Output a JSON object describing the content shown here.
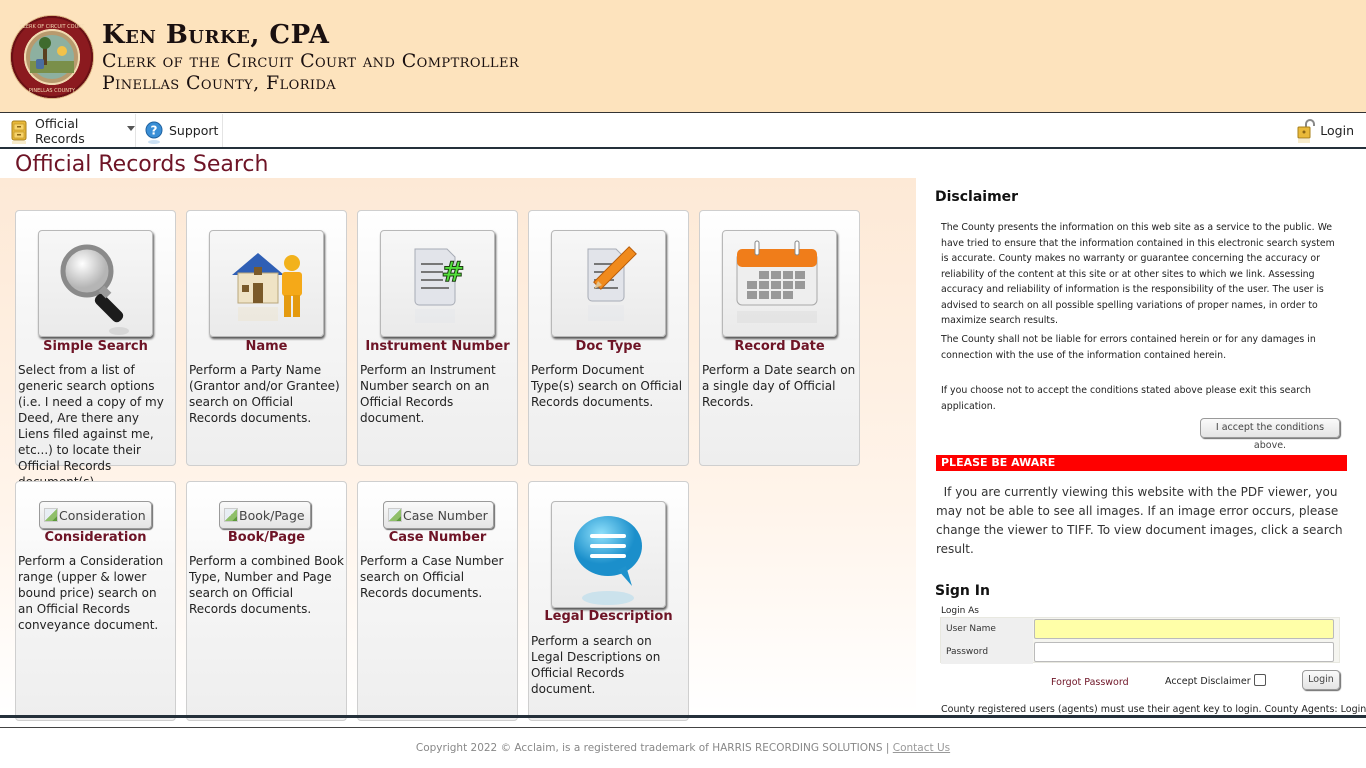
{
  "header": {
    "seal_alt": "Clerk of the Circuit Court & Comptroller Pinellas County Florida seal",
    "title": "Ken Burke, CPA",
    "subtitle_1": "Clerk of the Circuit Court and Comptroller",
    "subtitle_2": "Pinellas County, Florida"
  },
  "nav": {
    "items": [
      {
        "label": "Official Records",
        "icon": "file-cabinet-icon",
        "has_dropdown": true
      },
      {
        "label": "Support",
        "icon": "help-icon",
        "has_dropdown": false
      }
    ],
    "login_label": "Login"
  },
  "page_title": "Official Records Search",
  "search_tiles": [
    {
      "title": "Simple Search",
      "icon": "magnifier-icon",
      "description": "Select from a list of generic search options (i.e. I need a copy of my Deed, Are there any Liens filed against me, etc...) to locate their Official Records document(s)."
    },
    {
      "title": "Name",
      "icon": "house-person-icon",
      "description": "Perform a Party Name (Grantor and/or Grantee) search on Official Records documents."
    },
    {
      "title": "Instrument Number",
      "icon": "document-number-icon",
      "description": "Perform an Instrument Number search on an Official Records document."
    },
    {
      "title": "Doc Type",
      "icon": "document-pencil-icon",
      "description": "Perform Document Type(s) search on Official Records documents."
    },
    {
      "title": "Record Date",
      "icon": "calendar-icon",
      "description": "Perform a Date search on a single day of Official Records."
    },
    {
      "title": "Consideration",
      "button_alt": "Consideration",
      "description": "Perform a Consideration range (upper & lower bound price) search on an Official Records conveyance document."
    },
    {
      "title": "Book/Page",
      "button_alt": "Book/Page",
      "description": "Perform a combined Book Type, Number and Page search on Official Records documents."
    },
    {
      "title": "Case Number",
      "button_alt": "Case Number",
      "description": "Perform a Case Number search on Official Records documents."
    },
    {
      "title": "Legal Description",
      "icon": "speech-bubble-icon",
      "description": "Perform a search on Legal Descriptions on Official Records document."
    }
  ],
  "disclaimer": {
    "title": "Disclaimer",
    "paragraph_1": "The County presents the information on this web site as a service to the public. We have tried to ensure that the information contained in this electronic search system is accurate. County makes no warranty or guarantee concerning the accuracy or reliability of the content at this site or at other sites to which we link. Assessing accuracy and reliability of information is the responsibility of the user. The user is advised to search on all possible spelling variations of proper names, in order to maximize search results.",
    "paragraph_2": "The County shall not be liable for errors contained herein or for any damages in connection with the use of the information contained herein.",
    "paragraph_3": "If you choose not to accept the conditions stated above please exit this search application.",
    "accept_button": "I accept the conditions above."
  },
  "notice": {
    "heading": "PLEASE BE AWARE",
    "text": "If you are currently viewing this website with the PDF viewer, you may not be able to see all images. If an image error occurs, please change the viewer to TIFF. To view document images, click a search result.",
    "color": "#ff0000"
  },
  "sign_in": {
    "title": "Sign In",
    "login_as": "Login As",
    "username_label": "User Name",
    "username_value": "",
    "password_label": "Password",
    "password_value": "",
    "forgot_password": "Forgot Password",
    "accept_disclaimer": "Accept Disclaimer",
    "accept_disclaimer_checked": false,
    "login_button": "Login",
    "agents_note": "County registered users (agents) must use their agent key to login. County Agents: Login"
  },
  "footer": {
    "copyright": "Copyright 2022 © Acclaim, is a registered trademark of HARRIS RECORDING SOLUTIONS | ",
    "contact_link": "Contact Us"
  },
  "colors": {
    "header_bg": "#fde3bd",
    "accent_maroon": "#6e1426",
    "nav_border": "#24303a"
  }
}
